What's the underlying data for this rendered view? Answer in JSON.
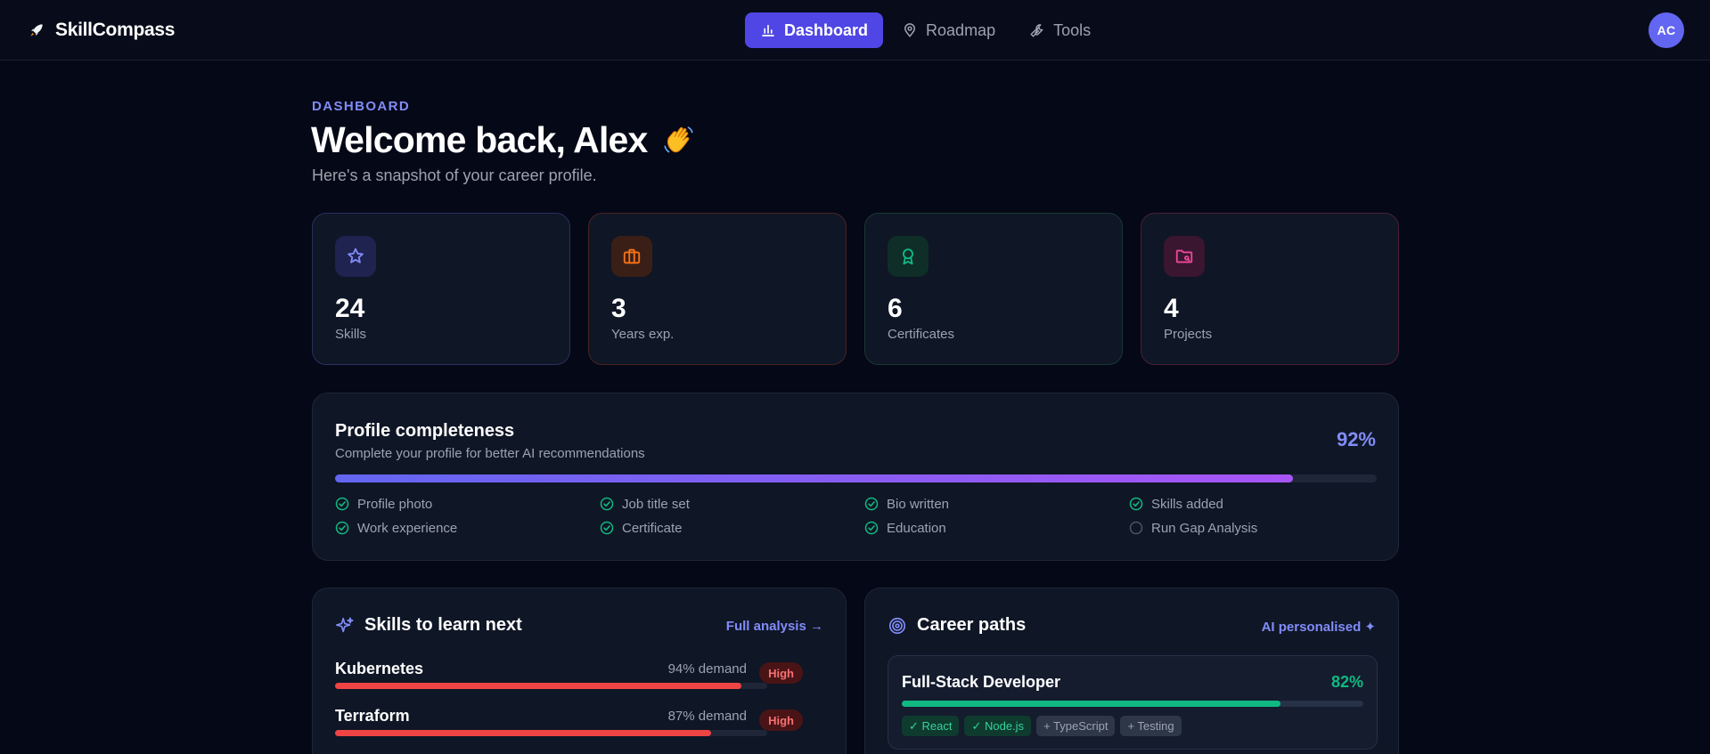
{
  "app": {
    "name": "SkillCompass",
    "logo_icon": "rocket-icon"
  },
  "nav": {
    "items": [
      {
        "label": "Dashboard",
        "icon": "bar-chart-icon",
        "active": true
      },
      {
        "label": "Roadmap",
        "icon": "map-pin-icon",
        "active": false
      },
      {
        "label": "Tools",
        "icon": "wrench-icon",
        "active": false
      }
    ],
    "avatar_initials": "AC"
  },
  "header": {
    "eyebrow": "DASHBOARD",
    "title": "Welcome back, Alex",
    "title_emoji_icon": "waving-hand-icon",
    "subtitle": "Here's a snapshot of your career profile."
  },
  "stats": [
    {
      "value": "24",
      "label": "Skills",
      "icon": "star-icon",
      "accent": "#6366f1"
    },
    {
      "value": "3",
      "label": "Years exp.",
      "icon": "briefcase-icon",
      "accent": "#f97316"
    },
    {
      "value": "6",
      "label": "Certificates",
      "icon": "award-icon",
      "accent": "#10b981"
    },
    {
      "value": "4",
      "label": "Projects",
      "icon": "folder-icon",
      "accent": "#ec4899"
    }
  ],
  "profile": {
    "title": "Profile completeness",
    "subtitle": "Complete your profile for better AI recommendations",
    "percent_label": "92%",
    "percent": 92,
    "checklist": [
      {
        "label": "Profile photo",
        "done": true
      },
      {
        "label": "Job title set",
        "done": true
      },
      {
        "label": "Bio written",
        "done": true
      },
      {
        "label": "Skills added",
        "done": true
      },
      {
        "label": "Work experience",
        "done": true
      },
      {
        "label": "Certificate",
        "done": true
      },
      {
        "label": "Education",
        "done": true
      },
      {
        "label": "Run Gap Analysis",
        "done": false
      }
    ]
  },
  "skills_panel": {
    "title": "Skills to learn next",
    "icon": "sparkles-icon",
    "link": "Full analysis →",
    "items": [
      {
        "name": "Kubernetes",
        "demand": "94% demand",
        "demand_value": 94,
        "badge": "High"
      },
      {
        "name": "Terraform",
        "demand": "87% demand",
        "demand_value": 87,
        "badge": "High"
      }
    ]
  },
  "career_panel": {
    "title": "Career paths",
    "icon": "target-icon",
    "link": "AI personalised ✦",
    "paths": [
      {
        "name": "Full-Stack Developer",
        "match_label": "82%",
        "match": 82,
        "tags": [
          {
            "label": "✓ React",
            "have": true
          },
          {
            "label": "✓ Node.js",
            "have": true
          },
          {
            "label": "+ TypeScript",
            "have": false
          },
          {
            "label": "+ Testing",
            "have": false
          }
        ]
      }
    ]
  }
}
